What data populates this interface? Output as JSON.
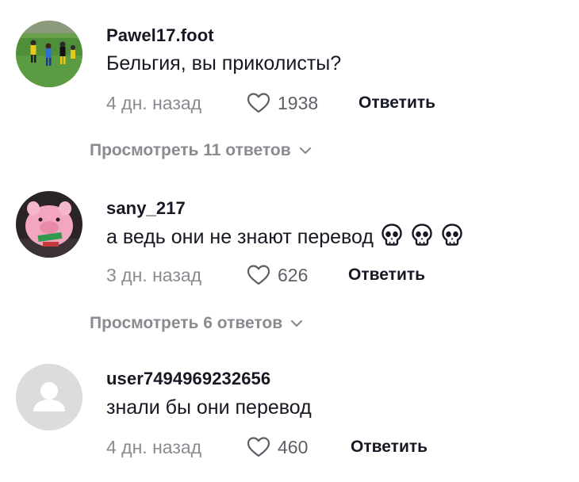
{
  "comments": [
    {
      "username": "Pawel17.foot",
      "text": "Бельгия, вы приколисты?",
      "time": "4 дн. назад",
      "likes": "1938",
      "reply_label": "Ответить",
      "avatar": "football-players-photo"
    },
    {
      "username": "sany_217",
      "text": "а ведь они не знают перевод",
      "emoji": [
        "skull-emoji",
        "skull-emoji",
        "skull-emoji"
      ],
      "time": "3 дн. назад",
      "likes": "626",
      "reply_label": "Ответить",
      "avatar": "pink-plush-toy-photo"
    },
    {
      "username": "user7494969232656",
      "text": "знали бы они перевод",
      "time": "4 дн. назад",
      "likes": "460",
      "reply_label": "Ответить",
      "avatar": "default-user-avatar"
    }
  ],
  "replies": [
    {
      "label": "Просмотреть 11 ответов"
    },
    {
      "label": "Просмотреть 6 ответов"
    }
  ],
  "colors": {
    "primary_text": "#161823",
    "secondary_text": "#8a8b91",
    "default_avatar_bg": "#dcdcdc"
  }
}
